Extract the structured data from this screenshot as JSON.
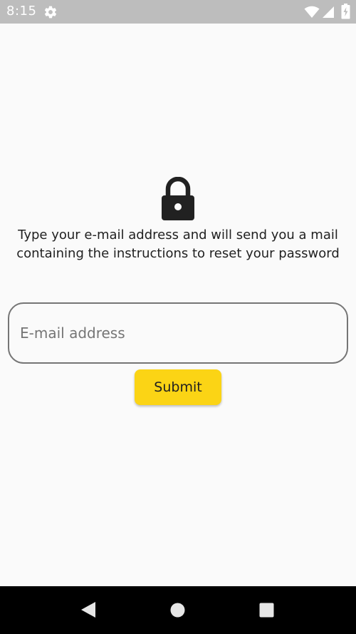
{
  "status_bar": {
    "time": "8:15",
    "icons": [
      "gear-icon",
      "wifi-icon",
      "signal-icon",
      "battery-icon"
    ]
  },
  "main": {
    "icon": "lock-icon",
    "message": "Type your e-mail address and will send you a mail containing the instructions to reset your password",
    "email_field": {
      "placeholder": "E-mail address",
      "value": ""
    },
    "submit_label": "Submit"
  },
  "nav_bar": {
    "icons": [
      "back-icon",
      "home-icon",
      "recents-icon"
    ]
  },
  "colors": {
    "background": "#fafafa",
    "status_bar": "#bdbdbd",
    "accent_button": "#fbd415",
    "nav_bar": "#000000",
    "field_border": "#757575"
  }
}
